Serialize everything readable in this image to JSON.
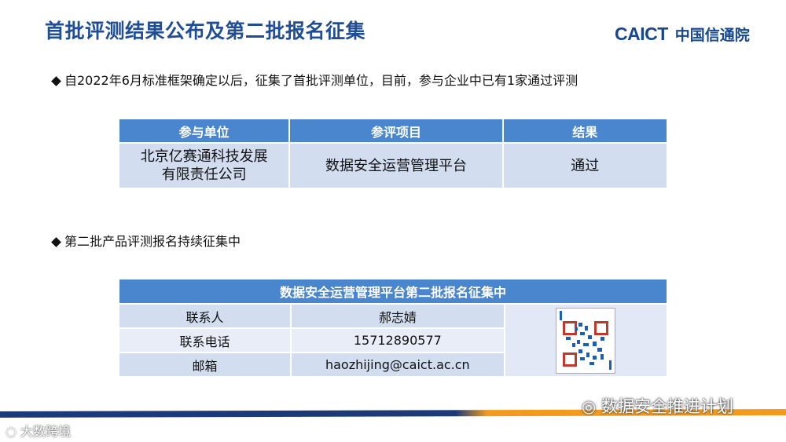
{
  "header": {
    "title": "首批评测结果公布及第二批报名征集",
    "logo_en": "CAICT",
    "logo_cn": "中国信通院"
  },
  "bullets": {
    "first": "自2022年6月标准框架确定以后，征集了首批评测单位，目前，参与企业中已有1家通过评测",
    "second": "第二批产品评测报名持续征集中"
  },
  "results_table": {
    "headers": [
      "参与单位",
      "参评项目",
      "结果"
    ],
    "rows": [
      {
        "unit_line1": "北京亿赛通科技发展",
        "unit_line2": "有限责任公司",
        "project": "数据安全运营管理平台",
        "result": "通过"
      }
    ]
  },
  "contact_table": {
    "title": "数据安全运营管理平台第二批报名征集中",
    "rows": [
      {
        "label": "联系人",
        "value": "郝志婧"
      },
      {
        "label": "联系电话",
        "value": "15712890577"
      },
      {
        "label": "邮箱",
        "value": "haozhijing@caict.ac.cn"
      }
    ]
  },
  "watermarks": {
    "wechat": "数据安全推进计划",
    "corner": "大数跨境"
  },
  "colors": {
    "title_blue": "#1f4e96",
    "header_blue": "#4a86cd",
    "cell_blue": "#d2ddf0",
    "footer_navy": "#1c3a78",
    "footer_orange": "#f39a1e"
  }
}
